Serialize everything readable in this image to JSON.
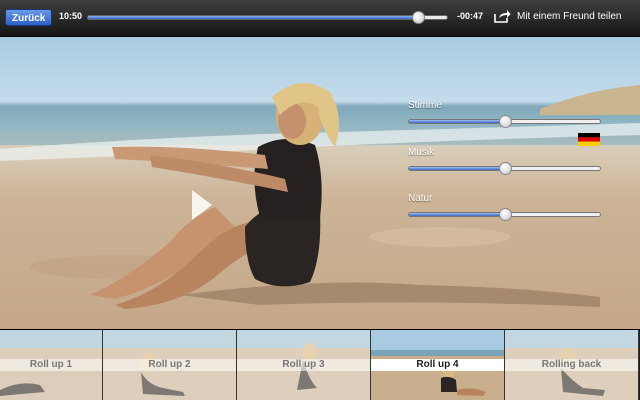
{
  "toolbar": {
    "back_label": "Zurück",
    "elapsed": "10:50",
    "remaining": "-00:47",
    "progress": 0.92,
    "share_label": "Mit einem Freund teilen"
  },
  "icons": {
    "share": "share-arrow-icon",
    "play": "play-icon",
    "flag": "german-flag-icon"
  },
  "sliders": [
    {
      "label": "Stimme",
      "value": 0.5
    },
    {
      "label": "Musik",
      "value": 0.5
    },
    {
      "label": "Natur",
      "value": 0.5
    }
  ],
  "chapters": [
    {
      "label": "Roll up 1",
      "selected": false
    },
    {
      "label": "Roll up 2",
      "selected": false
    },
    {
      "label": "Roll up 3",
      "selected": false
    },
    {
      "label": "Roll up 4",
      "selected": true
    },
    {
      "label": "Rolling back",
      "selected": false
    }
  ],
  "colors": {
    "accent": "#2b5fc4",
    "flag": [
      "#000000",
      "#dd0000",
      "#ffce00"
    ]
  }
}
